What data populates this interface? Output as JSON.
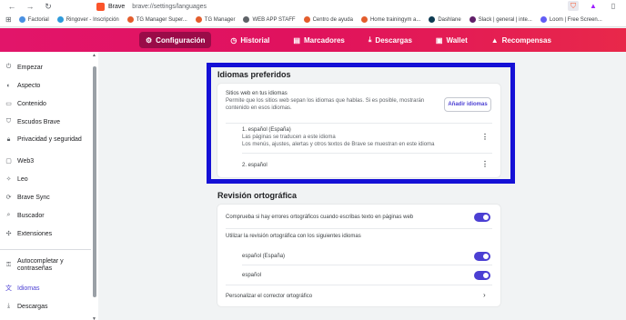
{
  "addressbar": {
    "site_name": "Brave",
    "url": "brave://settings/languages"
  },
  "bookmarks": [
    {
      "label": "Factorial",
      "color": "#4a90e2"
    },
    {
      "label": "Ringover - Inscripción",
      "color": "#2f9bda"
    },
    {
      "label": "TG Manager Super...",
      "color": "#e35d2d"
    },
    {
      "label": "TG Manager",
      "color": "#e35d2d"
    },
    {
      "label": "WEB APP STAFF",
      "color": "#5f6368"
    },
    {
      "label": "Centro de ayuda",
      "color": "#e35d2d"
    },
    {
      "label": "Home trainingym a...",
      "color": "#e35d2d"
    },
    {
      "label": "Dashlane",
      "color": "#0e3b52"
    },
    {
      "label": "Slack | general | inte...",
      "color": "#611f69"
    },
    {
      "label": "Loom | Free Screen...",
      "color": "#625df5"
    }
  ],
  "topnav": {
    "tabs": [
      {
        "label": "Configuración",
        "icon": "gear-icon",
        "glyph": "⚙",
        "active": true
      },
      {
        "label": "Historial",
        "icon": "clock-icon",
        "glyph": "◷",
        "active": false
      },
      {
        "label": "Marcadores",
        "icon": "bookmark-icon",
        "glyph": "▤",
        "active": false
      },
      {
        "label": "Descargas",
        "icon": "download-icon",
        "glyph": "⤓",
        "active": false
      },
      {
        "label": "Wallet",
        "icon": "wallet-icon",
        "glyph": "▣",
        "active": false
      },
      {
        "label": "Recompensas",
        "icon": "bat-icon",
        "glyph": "▲",
        "active": false
      }
    ]
  },
  "sidebar": {
    "items": [
      {
        "label": "Empezar",
        "icon": "power-icon",
        "glyph": "⏻"
      },
      {
        "label": "Aspecto",
        "icon": "palette-icon",
        "glyph": "◐"
      },
      {
        "label": "Contenido",
        "icon": "content-icon",
        "glyph": "▭"
      },
      {
        "label": "Escudos Brave",
        "icon": "shield-icon",
        "glyph": "⛉"
      },
      {
        "label": "Privacidad y seguridad",
        "icon": "lock-icon",
        "glyph": "🔒︎"
      },
      {
        "label": "Web3",
        "icon": "web3-icon",
        "glyph": "▢"
      },
      {
        "label": "Leo",
        "icon": "leo-icon",
        "glyph": "✧"
      },
      {
        "label": "Brave Sync",
        "icon": "sync-icon",
        "glyph": "⟳"
      },
      {
        "label": "Buscador",
        "icon": "search-icon",
        "glyph": "⌕"
      },
      {
        "label": "Extensiones",
        "icon": "puzzle-icon",
        "glyph": "✣"
      },
      {
        "label": "Autocompletar y contraseñas",
        "icon": "key-icon",
        "glyph": "⚿"
      },
      {
        "label": "Idiomas",
        "icon": "translate-icon",
        "glyph": "文",
        "active": true
      },
      {
        "label": "Descargas",
        "icon": "download-icon",
        "glyph": "⤓"
      }
    ]
  },
  "languages": {
    "title": "Idiomas preferidos",
    "sites_heading": "Sitios web en tus idiomas",
    "sites_description": "Permite que los sitios web sepan los idiomas que hablas. Si es posible, mostrarán contenido en esos idiomas.",
    "add_button": "Añadir idiomas",
    "list": [
      {
        "name": "1. español (España)",
        "line1": "Las páginas se traducen a este idioma",
        "line2": "Los menús, ajustes, alertas y otros textos de Brave se muestran en este idioma"
      },
      {
        "name": "2. español"
      }
    ]
  },
  "spellcheck": {
    "title": "Revisión ortográfica",
    "toggle_label": "Comprueba si hay errores ortográficos cuando escribas texto en páginas web",
    "languages_label": "Utilizar la revisión ortográfica con los siguientes idiomas",
    "languages": [
      "español (España)",
      "español"
    ],
    "customize_label": "Personalizar el corrector ortográfico"
  },
  "colors": {
    "accent": "#4b3fd3",
    "brand_pink": "#e2156a",
    "highlight_border": "#1510d6"
  }
}
